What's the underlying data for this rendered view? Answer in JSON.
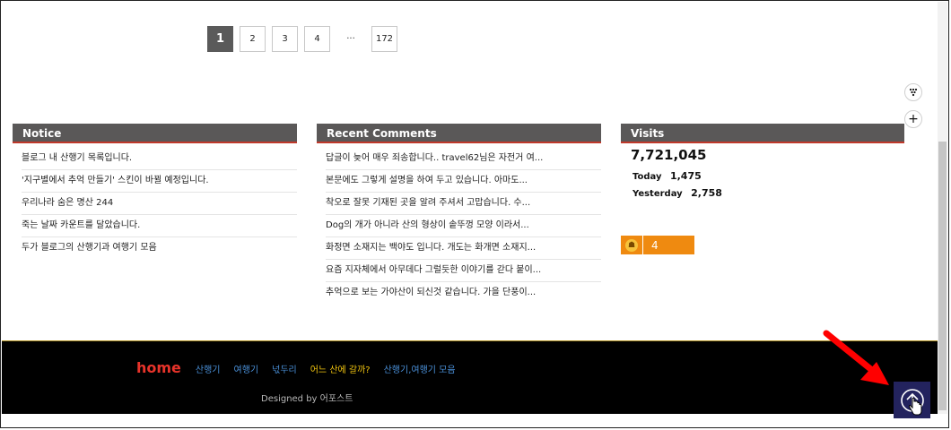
{
  "pagination": {
    "pages": [
      "1",
      "2",
      "3",
      "4"
    ],
    "ellipsis": "···",
    "last": "172"
  },
  "notice": {
    "title": "Notice",
    "items": [
      "블로그 내 산행기 목록입니다.",
      "'지구별에서 추억 만들기' 스킨이 바뀔 예정입니다.",
      "우리나라 숨은 명산 244",
      "죽는 날짜 카운트를 달았습니다.",
      "두가 블로그의 산행기과 여행기 모음"
    ]
  },
  "comments": {
    "title": "Recent Comments",
    "items": [
      "답글이 늦어 매우 죄송합니다.. travel62님은 자전거 여...",
      "본문에도 그렇게 설명을 하여 두고 있습니다. 아마도...",
      "착오로 잘못 기재된 곳을 알려 주셔서 고맙습니다. 수...",
      "Dog의 개가 아니라 산의 형상이 솥뚜껑 모양 이라서...",
      "화정면 소재지는 백야도 입니다. 개도는 화개면 소재지...",
      "요즘 지자체에서 아무데다 그럴듯한 이야기를 갇다 붙이...",
      "추억으로 보는 가야산이 되신것 같습니다. 가을 단풍이..."
    ]
  },
  "visits": {
    "title": "Visits",
    "total": "7,721,045",
    "today_label": "Today",
    "today_value": "1,475",
    "yesterday_label": "Yesterday",
    "yesterday_value": "2,758"
  },
  "badge": {
    "icon": "hiking-icon",
    "count": "4"
  },
  "footer": {
    "home": "home",
    "links": [
      {
        "label": "산행기",
        "color": "#4a90d9"
      },
      {
        "label": "여행기",
        "color": "#4a90d9"
      },
      {
        "label": "넋두리",
        "color": "#4a90d9"
      },
      {
        "label": "어느 산에 갈까?",
        "color": "#f1c40f"
      },
      {
        "label": "산행기,여행기 모음",
        "color": "#4a90d9"
      }
    ],
    "designed_by": "Designed by 어포스트"
  },
  "colors": {
    "accent": "#e8332a",
    "widget_header": "#5a5858",
    "badge": "#ef8a10",
    "to_top": "#23235e"
  }
}
